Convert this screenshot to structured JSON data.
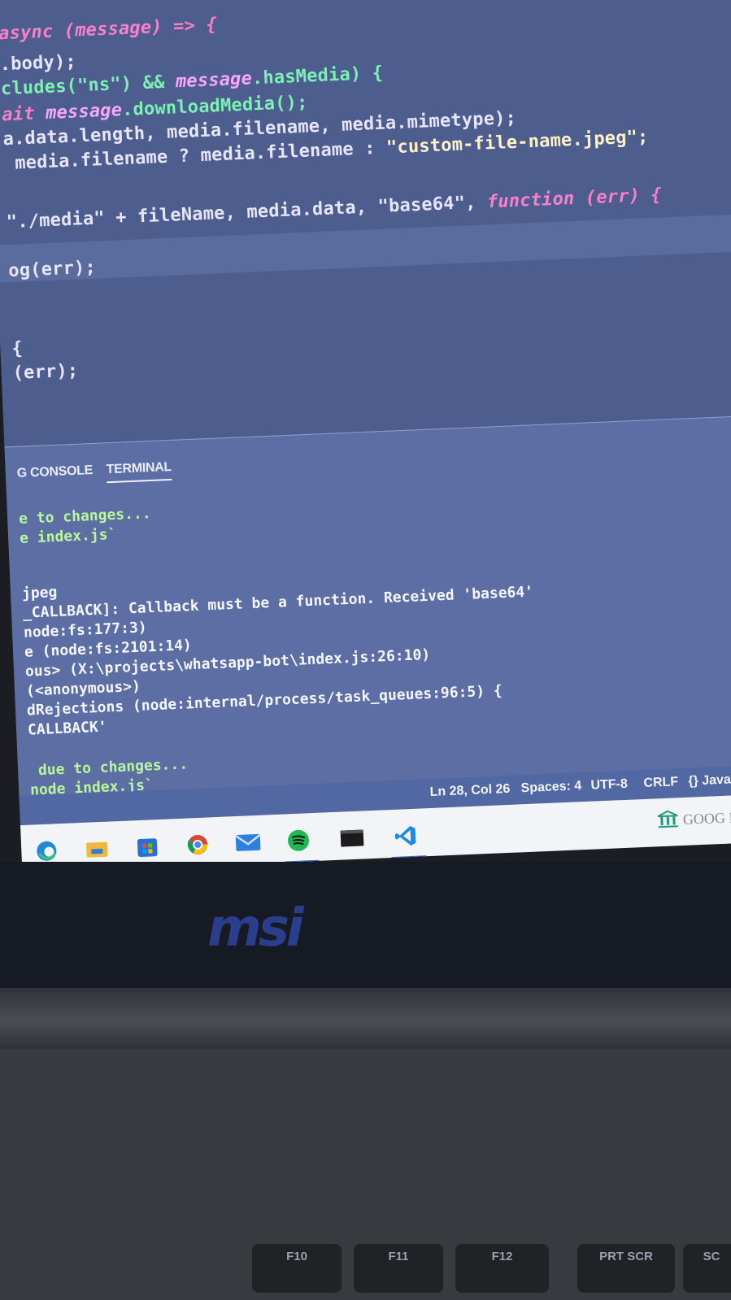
{
  "editor": {
    "lines": [
      [
        {
          "t": "async (message) => {",
          "c": "kw"
        }
      ],
      [
        {
          "t": ".body);",
          "c": "pl"
        }
      ],
      [
        {
          "t": "cludes(\"ns\") && ",
          "c": "fn"
        },
        {
          "t": "message",
          "c": "vr"
        },
        {
          "t": ".hasMedia) {",
          "c": "fn"
        }
      ],
      [
        {
          "t": "ait ",
          "c": "kw"
        },
        {
          "t": "message",
          "c": "vr"
        },
        {
          "t": ".downloadMedia();",
          "c": "fn"
        }
      ],
      [
        {
          "t": "a.data.length, media.filename, media.mimetype);",
          "c": "pl"
        }
      ],
      [
        {
          "t": " media.filename ? media.filename : ",
          "c": "pl"
        },
        {
          "t": "\"custom-file-name.jpeg\";",
          "c": "str"
        }
      ],
      [
        {
          "t": "\"./media\" + fileName, media.data, \"base64\", ",
          "c": "pl"
        },
        {
          "t": "function (err) {",
          "c": "kw"
        }
      ],
      [
        {
          "t": "og(err);",
          "c": "pl"
        }
      ],
      [
        {
          "t": "{",
          "c": "pl"
        }
      ],
      [
        {
          "t": "(err);",
          "c": "pl"
        }
      ]
    ]
  },
  "panel": {
    "tabs": [
      "G CONSOLE",
      "TERMINAL"
    ],
    "terminal_lines": [
      {
        "t": "e to changes...",
        "c": "green"
      },
      {
        "t": "e index.js`",
        "c": "green"
      },
      {
        "t": "jpeg",
        "c": "white"
      },
      {
        "t": "_CALLBACK]: Callback must be a function. Received 'base64'",
        "c": "white"
      },
      {
        "t": "node:fs:177:3)",
        "c": "white"
      },
      {
        "t": "e (node:fs:2101:14)",
        "c": "white"
      },
      {
        "t": "ous> (X:\\projects\\whatsapp-bot\\index.js:26:10)",
        "c": "white"
      },
      {
        "t": "(<anonymous>)",
        "c": "white"
      },
      {
        "t": "dRejections (node:internal/process/task_queues:96:5) {",
        "c": "white"
      },
      {
        "t": "CALLBACK'",
        "c": "white"
      },
      {
        "t": " due to changes...",
        "c": "green"
      },
      {
        "t": "node index.js`",
        "c": "green"
      }
    ]
  },
  "statusbar": {
    "position": "Ln 28, Col 26",
    "spaces": "Spaces: 4",
    "encoding": "UTF-8",
    "eol": "CRLF",
    "language": "{} JavaScr"
  },
  "taskbar": {
    "icons": [
      "edge-icon",
      "file-explorer-icon",
      "microsoft-store-icon",
      "chrome-icon",
      "mail-icon",
      "spotify-icon",
      "terminal-icon",
      "vscode-icon"
    ],
    "stock_widget": "GOOG Inv"
  },
  "laptop": {
    "brand": "msi",
    "keys": [
      "F10",
      "F11",
      "F12",
      "PRT SCR",
      "SC"
    ]
  },
  "colors": {
    "editor_bg": "#4d5d8d",
    "keyword": "#ff7fc8",
    "function": "#7df0b4",
    "string": "#fff1c6",
    "terminal_green": "#b8f79a",
    "statusbar": "#5268a3",
    "msi_logo": "#2b3e8e"
  }
}
